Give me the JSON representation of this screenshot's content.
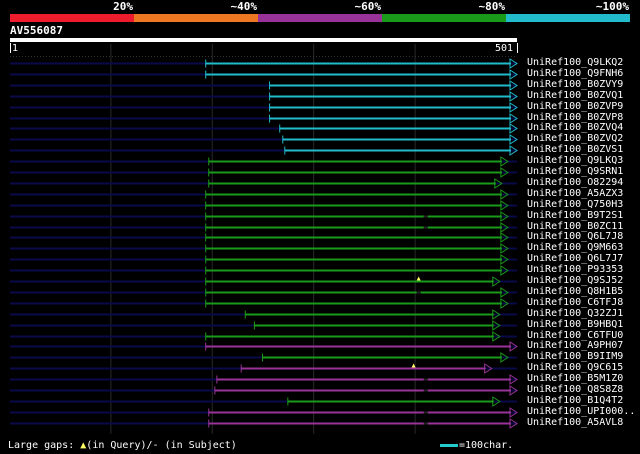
{
  "identity_legend": [
    {
      "label": "20%",
      "color": "#ee1c2c"
    },
    {
      "label": "~40%",
      "color": "#ee7722"
    },
    {
      "label": "~60%",
      "color": "#993399"
    },
    {
      "label": "~80%",
      "color": "#1a9a1a"
    },
    {
      "label": "~100%",
      "color": "#22bbcc"
    }
  ],
  "query": {
    "name": "AV556087",
    "length": 501,
    "start_label": "1",
    "end_label": "501"
  },
  "hits": [
    {
      "name": "UniRef100_Q9LKQ2",
      "start": 194,
      "end": 501,
      "color": "#22bbcc",
      "markers": []
    },
    {
      "name": "UniRef100_Q9FNH6",
      "start": 194,
      "end": 501,
      "color": "#22bbcc",
      "markers": []
    },
    {
      "name": "UniRef100_B0ZVY9",
      "start": 257,
      "end": 501,
      "color": "#22bbcc",
      "markers": []
    },
    {
      "name": "UniRef100_B0ZVQ1",
      "start": 257,
      "end": 501,
      "color": "#22bbcc",
      "markers": []
    },
    {
      "name": "UniRef100_B0ZVP9",
      "start": 257,
      "end": 501,
      "color": "#22bbcc",
      "markers": []
    },
    {
      "name": "UniRef100_B0ZVP8",
      "start": 257,
      "end": 501,
      "color": "#22bbcc",
      "markers": []
    },
    {
      "name": "UniRef100_B0ZVQ4",
      "start": 267,
      "end": 501,
      "color": "#22bbcc",
      "markers": []
    },
    {
      "name": "UniRef100_B0ZVQ2",
      "start": 270,
      "end": 501,
      "color": "#22bbcc",
      "markers": []
    },
    {
      "name": "UniRef100_B0ZVS1",
      "start": 272,
      "end": 501,
      "color": "#22bbcc",
      "markers": []
    },
    {
      "name": "UniRef100_Q9LKQ3",
      "start": 197,
      "end": 492,
      "color": "#1a9a1a",
      "markers": []
    },
    {
      "name": "UniRef100_Q9SRN1",
      "start": 197,
      "end": 492,
      "color": "#1a9a1a",
      "markers": []
    },
    {
      "name": "UniRef100_O82294",
      "start": 197,
      "end": 486,
      "color": "#1a9a1a",
      "markers": []
    },
    {
      "name": "UniRef100_A5AZX3",
      "start": 194,
      "end": 492,
      "color": "#1a9a1a",
      "markers": []
    },
    {
      "name": "UniRef100_Q750H3",
      "start": 194,
      "end": 492,
      "color": "#1a9a1a",
      "markers": []
    },
    {
      "name": "UniRef100_B9T2S1",
      "start": 194,
      "end": 492,
      "color": "#1a9a1a",
      "markers": [
        {
          "pos": 411,
          "type": "dash"
        }
      ]
    },
    {
      "name": "UniRef100_B0ZC11",
      "start": 194,
      "end": 492,
      "color": "#1a9a1a",
      "markers": [
        {
          "pos": 411,
          "type": "dash"
        }
      ]
    },
    {
      "name": "UniRef100_Q6L7J8",
      "start": 194,
      "end": 492,
      "color": "#1a9a1a",
      "markers": []
    },
    {
      "name": "UniRef100_Q9M663",
      "start": 194,
      "end": 492,
      "color": "#1a9a1a",
      "markers": []
    },
    {
      "name": "UniRef100_Q6L7J7",
      "start": 194,
      "end": 492,
      "color": "#1a9a1a",
      "markers": []
    },
    {
      "name": "UniRef100_P93353",
      "start": 194,
      "end": 492,
      "color": "#1a9a1a",
      "markers": []
    },
    {
      "name": "UniRef100_Q9SJ52",
      "start": 194,
      "end": 484,
      "color": "#1a9a1a",
      "markers": [
        {
          "pos": 404,
          "type": "triangle"
        }
      ]
    },
    {
      "name": "UniRef100_Q8H1B5",
      "start": 194,
      "end": 492,
      "color": "#1a9a1a",
      "markers": [
        {
          "pos": 404,
          "type": "dash"
        }
      ]
    },
    {
      "name": "UniRef100_C6TFJ8",
      "start": 194,
      "end": 492,
      "color": "#1a9a1a",
      "markers": []
    },
    {
      "name": "UniRef100_Q32ZJ1",
      "start": 233,
      "end": 484,
      "color": "#1a9a1a",
      "markers": []
    },
    {
      "name": "UniRef100_B9HBQ1",
      "start": 242,
      "end": 484,
      "color": "#1a9a1a",
      "markers": []
    },
    {
      "name": "UniRef100_C6TFU0",
      "start": 194,
      "end": 484,
      "color": "#1a9a1a",
      "markers": []
    },
    {
      "name": "UniRef100_A9PH07",
      "start": 194,
      "end": 501,
      "color": "#993399",
      "markers": []
    },
    {
      "name": "UniRef100_B9IIM9",
      "start": 250,
      "end": 492,
      "color": "#1a9a1a",
      "markers": []
    },
    {
      "name": "UniRef100_Q9C615",
      "start": 229,
      "end": 476,
      "color": "#993399",
      "markers": [
        {
          "pos": 399,
          "type": "triangle"
        }
      ]
    },
    {
      "name": "UniRef100_B5M1Z0",
      "start": 205,
      "end": 501,
      "color": "#993399",
      "markers": [
        {
          "pos": 411,
          "type": "dash"
        }
      ]
    },
    {
      "name": "UniRef100_Q8S8Z8",
      "start": 203,
      "end": 501,
      "color": "#993399",
      "markers": [
        {
          "pos": 411,
          "type": "dash"
        }
      ]
    },
    {
      "name": "UniRef100_B1Q4T2",
      "start": 275,
      "end": 484,
      "color": "#1a9a1a",
      "markers": []
    },
    {
      "name": "UniRef100_UPI000..",
      "start": 197,
      "end": 501,
      "color": "#993399",
      "markers": [
        {
          "pos": 411,
          "type": "dash"
        }
      ]
    },
    {
      "name": "UniRef100_A5AVL8",
      "start": 197,
      "end": 501,
      "color": "#993399",
      "markers": [
        {
          "pos": 411,
          "type": "dash"
        }
      ]
    }
  ],
  "footer": {
    "large_gaps_label": "Large gaps:",
    "query_gap_label": "(in Query)/",
    "subject_gap_label": "- (in Subject)",
    "triangle_glyph": "▲",
    "scale_label": "=100char."
  }
}
